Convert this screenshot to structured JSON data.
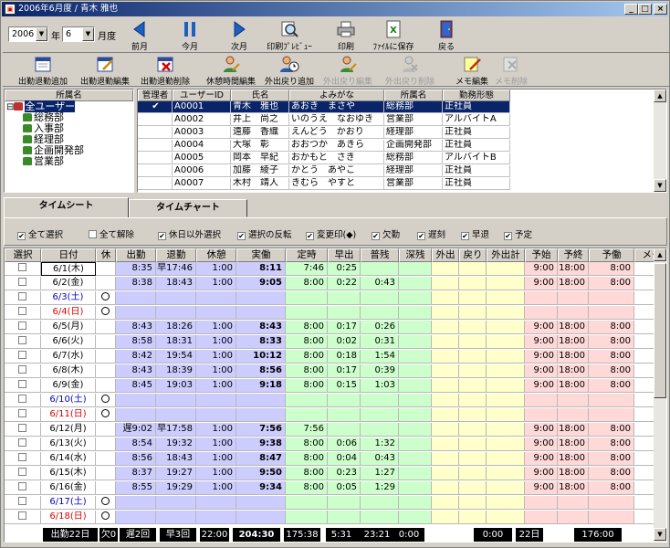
{
  "window": {
    "title": "2006年6月度 / 青木 雅也"
  },
  "period": {
    "year": "2006",
    "year_label": "年",
    "month": "6",
    "month_label": "月度"
  },
  "toolbar1": [
    {
      "id": "prev",
      "label": "前月",
      "icon": "prev-arrow-icon"
    },
    {
      "id": "today",
      "label": "今月",
      "icon": "pause-icon"
    },
    {
      "id": "next",
      "label": "次月",
      "icon": "next-arrow-icon"
    },
    {
      "id": "preview",
      "label": "印刷ﾌﾟﾚﾋﾞｭｰ",
      "icon": "print-preview-icon"
    },
    {
      "id": "print",
      "label": "印刷",
      "icon": "printer-icon"
    },
    {
      "id": "save",
      "label": "ﾌｧｲﾙに保存",
      "icon": "excel-file-icon"
    },
    {
      "id": "back",
      "label": "戻る",
      "icon": "exit-door-icon"
    }
  ],
  "toolbar2": [
    {
      "id": "add",
      "label": "出勤退勤追加",
      "enabled": true,
      "icon": "calendar-add-icon"
    },
    {
      "id": "edit",
      "label": "出勤退勤編集",
      "enabled": true,
      "icon": "calendar-edit-icon"
    },
    {
      "id": "delete",
      "label": "出勤退勤削除",
      "enabled": true,
      "icon": "calendar-delete-icon"
    },
    {
      "id": "rest",
      "label": "休憩時間編集",
      "enabled": true,
      "icon": "person-edit-icon"
    },
    {
      "id": "outadd",
      "label": "外出戻り追加",
      "enabled": true,
      "icon": "person-clock-icon"
    },
    {
      "id": "outedit",
      "label": "外出戻り編集",
      "enabled": false,
      "icon": "person-edit-icon"
    },
    {
      "id": "outdel",
      "label": "外出戻り削除",
      "enabled": false,
      "icon": "person-delete-icon"
    },
    {
      "id": "memo",
      "label": "メモ編集",
      "enabled": true,
      "icon": "memo-edit-icon"
    },
    {
      "id": "memodel",
      "label": "メモ削除",
      "enabled": false,
      "icon": "memo-delete-icon"
    }
  ],
  "tree": {
    "header": "所属名",
    "nodes": [
      {
        "label": "全ユーザー",
        "level": 0,
        "selected": true
      },
      {
        "label": "総務部",
        "level": 1
      },
      {
        "label": "入事部",
        "level": 1
      },
      {
        "label": "経理部",
        "level": 1
      },
      {
        "label": "企画開発部",
        "level": 1
      },
      {
        "label": "営業部",
        "level": 1
      }
    ]
  },
  "users": {
    "headers": [
      "管理者",
      "ユーザーID",
      "氏名",
      "よみがな",
      "所属名",
      "勤務形態"
    ],
    "rows": [
      [
        "✔",
        "A0001",
        "青木　雅也",
        "あおき　まさや",
        "総務部",
        "正社員"
      ],
      [
        "",
        "A0002",
        "井上　尚之",
        "いのうえ　なおゆき",
        "営業部",
        "アルバイトA"
      ],
      [
        "",
        "A0003",
        "遠藤　香織",
        "えんどう　かおり",
        "経理部",
        "正社員"
      ],
      [
        "",
        "A0004",
        "大塚　彰",
        "おおつか　あきら",
        "企画開発部",
        "正社員"
      ],
      [
        "",
        "A0005",
        "岡本　早紀",
        "おかもと　さき",
        "総務部",
        "アルバイトB"
      ],
      [
        "",
        "A0006",
        "加藤　綾子",
        "かとう　あやこ",
        "経理部",
        "正社員"
      ],
      [
        "",
        "A0007",
        "木村　靖人",
        "きむら　やすと",
        "営業部",
        "正社員"
      ]
    ]
  },
  "tabs": [
    "タイムシート",
    "タイムチャート"
  ],
  "checks": [
    {
      "label": "全て選択",
      "checked": true
    },
    {
      "label": "全て解除",
      "checked": false
    },
    {
      "label": "休日以外選択",
      "checked": true
    },
    {
      "label": "選択の反転",
      "checked": true
    },
    {
      "label": "変更印(◆)",
      "checked": true
    },
    {
      "label": "欠勤",
      "checked": true
    },
    {
      "label": "遅刻",
      "checked": true
    },
    {
      "label": "早退",
      "checked": true
    },
    {
      "label": "予定",
      "checked": true
    }
  ],
  "sheet": {
    "headers": [
      "選択",
      "日付",
      "休",
      "出勤",
      "退勤",
      "休憩",
      "実働",
      "定時",
      "早出",
      "普残",
      "深残",
      "外出",
      "戻り",
      "外出計",
      "予始",
      "予終",
      "予働",
      "メモ"
    ],
    "rows": [
      {
        "date": "6/1(木)",
        "type": "w",
        "in": "8:35",
        "out": "早17:46",
        "rest": "1:00",
        "work": "8:11",
        "teiji": "7:46",
        "hayade": "0:25",
        "fuzan": "",
        "ys": "9:00",
        "ye": "18:00",
        "yw": "8:00",
        "sel": true
      },
      {
        "date": "6/2(金)",
        "type": "w",
        "in": "8:38",
        "out": "18:43",
        "rest": "1:00",
        "work": "9:05",
        "teiji": "8:00",
        "hayade": "0:22",
        "fuzan": "0:43",
        "ys": "9:00",
        "ye": "18:00",
        "yw": "8:00"
      },
      {
        "date": "6/3(土)",
        "type": "sat",
        "hol": true
      },
      {
        "date": "6/4(日)",
        "type": "sun",
        "hol": true
      },
      {
        "date": "6/5(月)",
        "type": "w",
        "in": "8:43",
        "out": "18:26",
        "rest": "1:00",
        "work": "8:43",
        "teiji": "8:00",
        "hayade": "0:17",
        "fuzan": "0:26",
        "ys": "9:00",
        "ye": "18:00",
        "yw": "8:00"
      },
      {
        "date": "6/6(火)",
        "type": "w",
        "in": "8:58",
        "out": "18:31",
        "rest": "1:00",
        "work": "8:33",
        "teiji": "8:00",
        "hayade": "0:02",
        "fuzan": "0:31",
        "ys": "9:00",
        "ye": "18:00",
        "yw": "8:00"
      },
      {
        "date": "6/7(水)",
        "type": "w",
        "in": "8:42",
        "out": "19:54",
        "rest": "1:00",
        "work": "10:12",
        "teiji": "8:00",
        "hayade": "0:18",
        "fuzan": "1:54",
        "ys": "9:00",
        "ye": "18:00",
        "yw": "8:00"
      },
      {
        "date": "6/8(木)",
        "type": "w",
        "in": "8:43",
        "out": "18:39",
        "rest": "1:00",
        "work": "8:56",
        "teiji": "8:00",
        "hayade": "0:17",
        "fuzan": "0:39",
        "ys": "9:00",
        "ye": "18:00",
        "yw": "8:00"
      },
      {
        "date": "6/9(金)",
        "type": "w",
        "in": "8:45",
        "out": "19:03",
        "rest": "1:00",
        "work": "9:18",
        "teiji": "8:00",
        "hayade": "0:15",
        "fuzan": "1:03",
        "ys": "9:00",
        "ye": "18:00",
        "yw": "8:00"
      },
      {
        "date": "6/10(土)",
        "type": "sat",
        "hol": true
      },
      {
        "date": "6/11(日)",
        "type": "sun",
        "hol": true
      },
      {
        "date": "6/12(月)",
        "type": "w",
        "in": "遅9:02",
        "out": "早17:58",
        "rest": "1:00",
        "work": "7:56",
        "teiji": "7:56",
        "hayade": "",
        "fuzan": "",
        "ys": "9:00",
        "ye": "18:00",
        "yw": "8:00"
      },
      {
        "date": "6/13(火)",
        "type": "w",
        "in": "8:54",
        "out": "19:32",
        "rest": "1:00",
        "work": "9:38",
        "teiji": "8:00",
        "hayade": "0:06",
        "fuzan": "1:32",
        "ys": "9:00",
        "ye": "18:00",
        "yw": "8:00"
      },
      {
        "date": "6/14(水)",
        "type": "w",
        "in": "8:56",
        "out": "18:43",
        "rest": "1:00",
        "work": "8:47",
        "teiji": "8:00",
        "hayade": "0:04",
        "fuzan": "0:43",
        "ys": "9:00",
        "ye": "18:00",
        "yw": "8:00"
      },
      {
        "date": "6/15(木)",
        "type": "w",
        "in": "8:37",
        "out": "19:27",
        "rest": "1:00",
        "work": "9:50",
        "teiji": "8:00",
        "hayade": "0:23",
        "fuzan": "1:27",
        "ys": "9:00",
        "ye": "18:00",
        "yw": "8:00"
      },
      {
        "date": "6/16(金)",
        "type": "w",
        "in": "8:55",
        "out": "19:29",
        "rest": "1:00",
        "work": "9:34",
        "teiji": "8:00",
        "hayade": "0:05",
        "fuzan": "1:29",
        "ys": "9:00",
        "ye": "18:00",
        "yw": "8:00"
      },
      {
        "date": "6/17(土)",
        "type": "sat",
        "hol": true
      },
      {
        "date": "6/18(日)",
        "type": "sun",
        "hol": true
      }
    ],
    "footer": [
      "出勤22日",
      "欠0",
      "遅2回",
      "早3回",
      "22:00",
      "204:30",
      "175:38",
      "5:31",
      "23:21",
      "0:00",
      "0:00",
      "22日",
      "176:00"
    ]
  },
  "colors": {
    "blue": "#ccccff",
    "green": "#ccffcc",
    "yellow": "#ffffcc",
    "pink": "#ffd8d8",
    "select": "#0a246a"
  }
}
